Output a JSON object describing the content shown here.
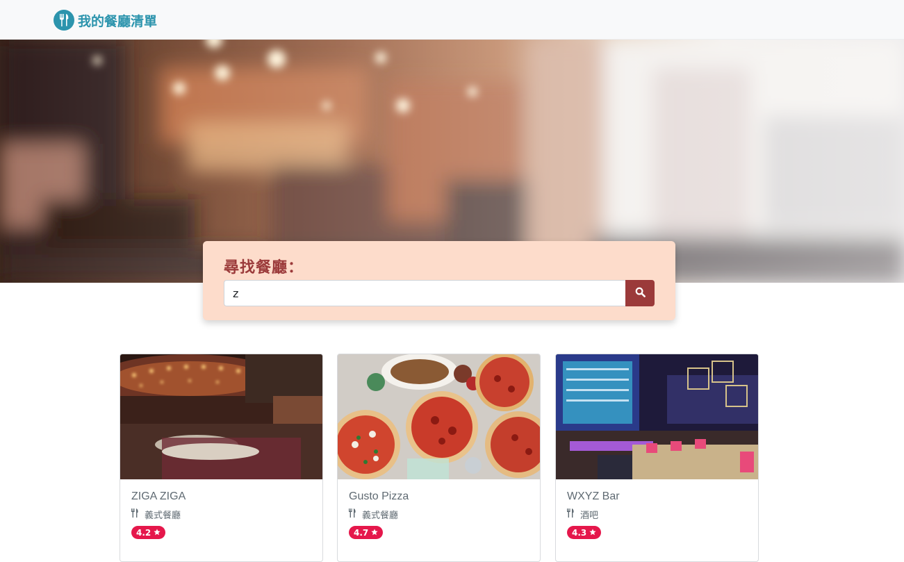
{
  "navbar": {
    "brand_icon": "utensils-icon",
    "brand_title": "我的餐廳清單",
    "brand_color": "#2c94ad"
  },
  "search": {
    "title": "尋找餐廳：",
    "value": "z",
    "button_icon": "search-icon",
    "accent_color": "#9b3a3a"
  },
  "restaurants": [
    {
      "name": "ZIGA ZIGA",
      "category_icon": "utensils-icon",
      "category": "義式餐廳",
      "rating": "4.2",
      "rating_icon": "star-icon"
    },
    {
      "name": "Gusto Pizza",
      "category_icon": "utensils-icon",
      "category": "義式餐廳",
      "rating": "4.7",
      "rating_icon": "star-icon"
    },
    {
      "name": "WXYZ Bar",
      "category_icon": "utensils-icon",
      "category": "酒吧",
      "rating": "4.3",
      "rating_icon": "star-icon"
    }
  ],
  "badge_color": "#e5174b"
}
